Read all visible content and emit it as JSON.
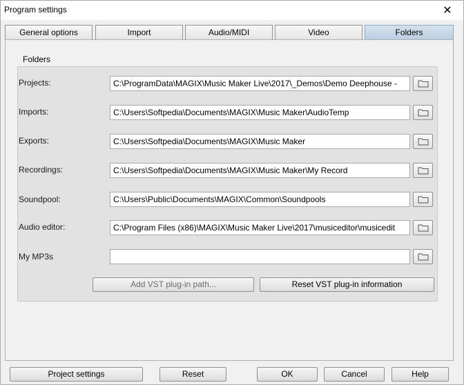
{
  "window": {
    "title": "Program settings",
    "close_glyph": "✕"
  },
  "tabs": [
    {
      "label": "General options"
    },
    {
      "label": "Import"
    },
    {
      "label": "Audio/MIDI"
    },
    {
      "label": "Video"
    },
    {
      "label": "Folders",
      "active": true
    }
  ],
  "folders": {
    "group_title": "Folders",
    "rows": [
      {
        "label": "Projects:",
        "value": "C:\\ProgramData\\MAGIX\\Music Maker Live\\2017\\_Demos\\Demo Deephouse -"
      },
      {
        "label": "Imports:",
        "value": "C:\\Users\\Softpedia\\Documents\\MAGIX\\Music Maker\\AudioTemp"
      },
      {
        "label": "Exports:",
        "value": "C:\\Users\\Softpedia\\Documents\\MAGIX\\Music Maker"
      },
      {
        "label": "Recordings:",
        "value": "C:\\Users\\Softpedia\\Documents\\MAGIX\\Music Maker\\My Record"
      },
      {
        "label": "Soundpool:",
        "value": "C:\\Users\\Public\\Documents\\MAGIX\\Common\\Soundpools"
      },
      {
        "label": "Audio editor:",
        "value": "C:\\Program Files (x86)\\MAGIX\\Music Maker Live\\2017\\musiceditor\\musicedit"
      },
      {
        "label": "My MP3s",
        "value": ""
      }
    ],
    "add_vst_label": "Add VST plug-in path...",
    "reset_vst_label": "Reset VST plug-in information"
  },
  "footer": {
    "project_settings_label": "Project settings",
    "reset_label": "Reset",
    "ok_label": "OK",
    "cancel_label": "Cancel",
    "help_label": "Help"
  },
  "colors": {
    "active_tab": "#c7d7e8",
    "group_background": "#e2e2e2",
    "window_background": "#f0f0f0"
  },
  "icons": {
    "folder_button": "folder-icon",
    "close": "close-icon"
  }
}
